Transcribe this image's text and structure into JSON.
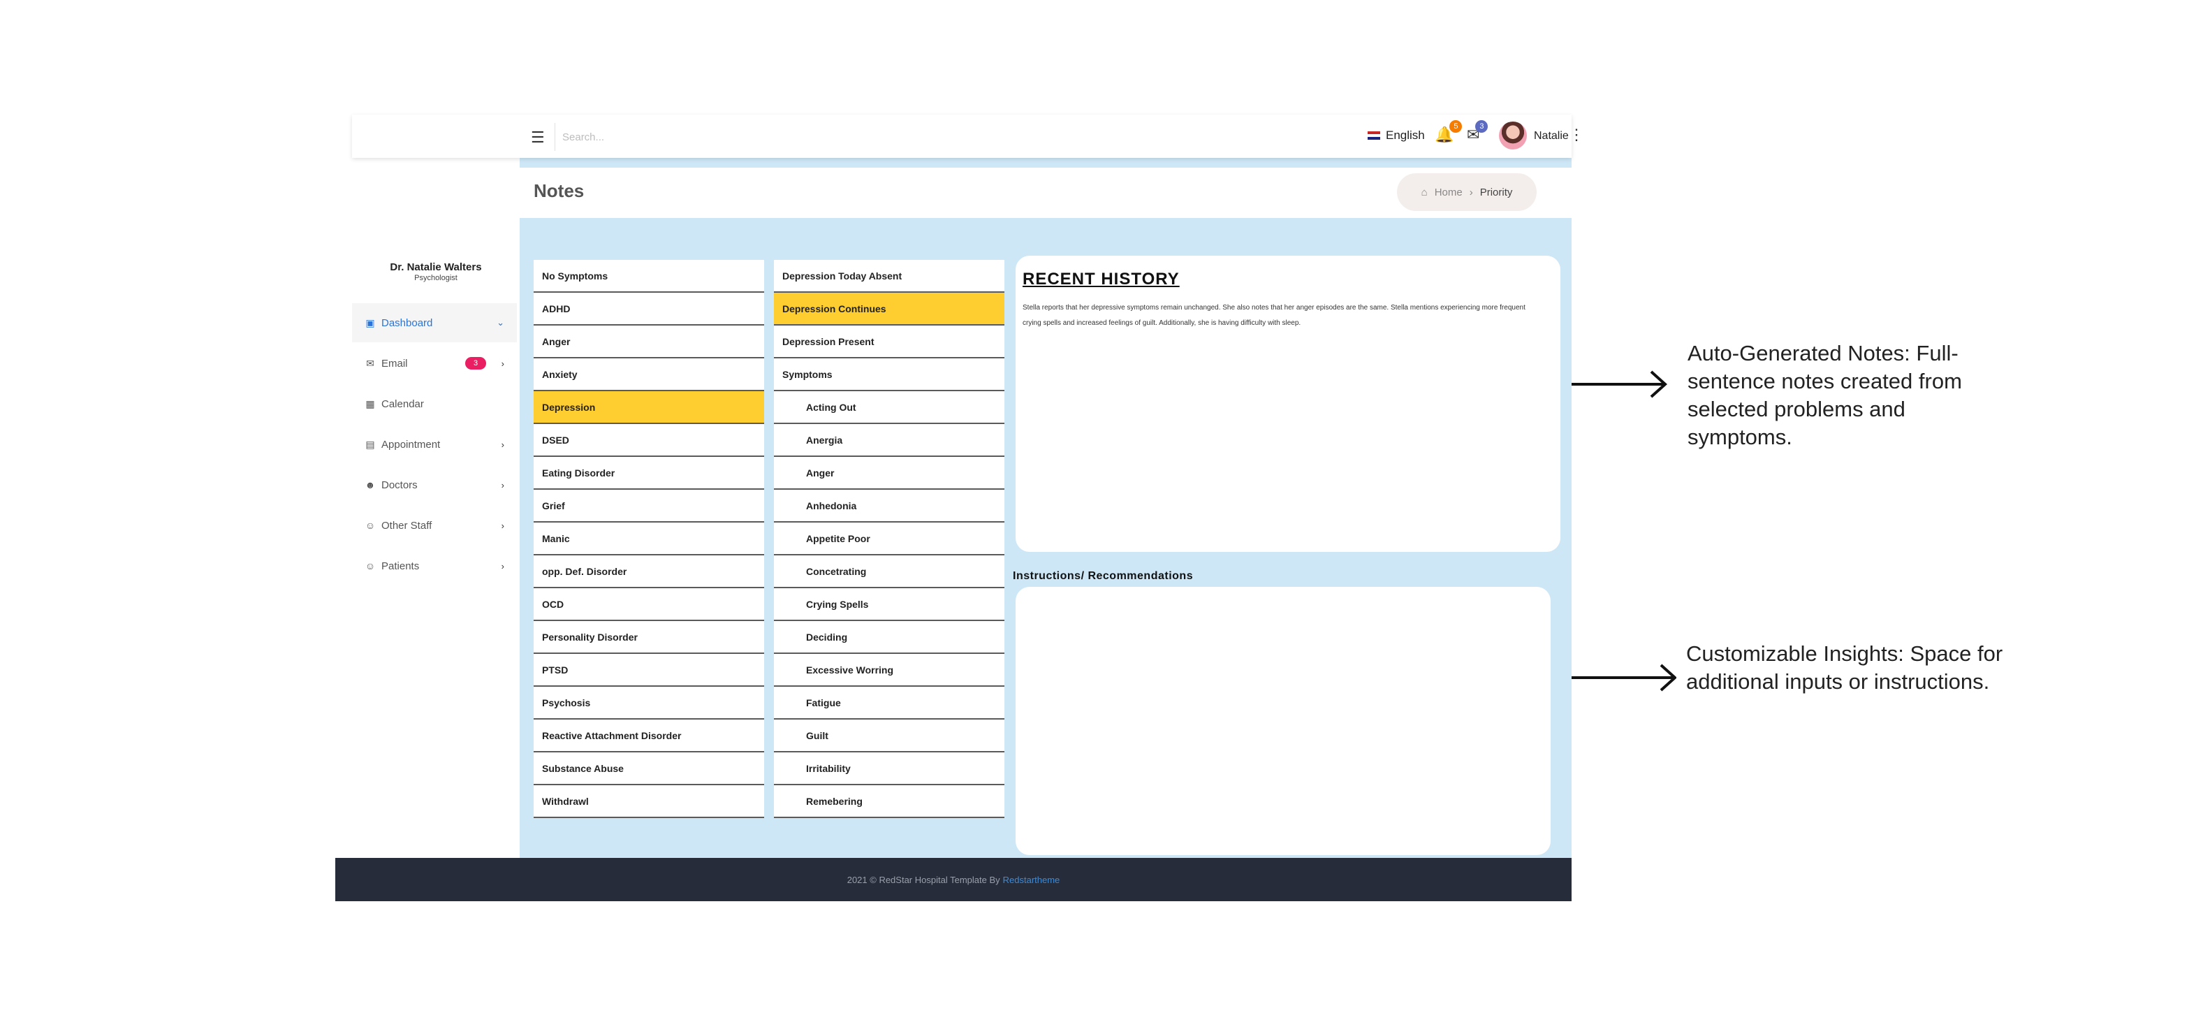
{
  "topbar": {
    "search_placeholder": "Search...",
    "language": "English",
    "notifications_count": "5",
    "messages_count": "3",
    "user_name": "Natalie",
    "menu_icon": "hamburger-icon",
    "colors": {
      "notif_badge": "#f57c00",
      "mail_badge": "#5c6bc0"
    }
  },
  "sidebar": {
    "doctor_name": "Dr. Natalie Walters",
    "doctor_role": "Psychologist",
    "items": [
      {
        "label": "Dashboard",
        "icon": "monitor-icon",
        "active": true
      },
      {
        "label": "Email",
        "icon": "mail-icon",
        "badge": "3"
      },
      {
        "label": "Calendar",
        "icon": "calendar-icon"
      },
      {
        "label": "Appointment",
        "icon": "book-icon"
      },
      {
        "label": "Doctors",
        "icon": "user-icon"
      },
      {
        "label": "Other Staff",
        "icon": "users-icon"
      },
      {
        "label": "Patients",
        "icon": "smile-icon"
      }
    ]
  },
  "header": {
    "title": "Notes",
    "breadcrumb": {
      "home": "Home",
      "current": "Priority"
    }
  },
  "problems": [
    {
      "label": "No Symptoms"
    },
    {
      "label": "ADHD"
    },
    {
      "label": "Anger"
    },
    {
      "label": "Anxiety"
    },
    {
      "label": "Depression",
      "selected": true
    },
    {
      "label": "DSED"
    },
    {
      "label": "Eating Disorder"
    },
    {
      "label": "Grief"
    },
    {
      "label": "Manic"
    },
    {
      "label": "opp. Def. Disorder"
    },
    {
      "label": "OCD"
    },
    {
      "label": "Personality Disorder"
    },
    {
      "label": "PTSD"
    },
    {
      "label": "Psychosis"
    },
    {
      "label": "Reactive Attachment Disorder"
    },
    {
      "label": "Substance Abuse"
    },
    {
      "label": "Withdrawl"
    }
  ],
  "symptoms": [
    {
      "label": "Depression Today Absent"
    },
    {
      "label": "Depression Continues",
      "selected": true
    },
    {
      "label": "Depression Present"
    },
    {
      "label": "Symptoms"
    },
    {
      "label": "Acting Out",
      "indent": true
    },
    {
      "label": "Anergia",
      "indent": true
    },
    {
      "label": "Anger",
      "indent": true
    },
    {
      "label": "Anhedonia",
      "indent": true
    },
    {
      "label": "Appetite Poor",
      "indent": true
    },
    {
      "label": "Concetrating",
      "indent": true
    },
    {
      "label": "Crying Spells",
      "indent": true
    },
    {
      "label": "Deciding",
      "indent": true
    },
    {
      "label": "Excessive Worring",
      "indent": true
    },
    {
      "label": "Fatigue",
      "indent": true
    },
    {
      "label": "Guilt",
      "indent": true
    },
    {
      "label": "Irritability",
      "indent": true
    },
    {
      "label": "Remebering",
      "indent": true
    }
  ],
  "history": {
    "title": "RECENT HISTORY",
    "text": "Stella reports that her depressive symptoms remain unchanged. She also notes that her anger episodes are the same. Stella mentions experiencing more frequent crying spells and increased feelings of guilt. Additionally, she is having difficulty with sleep."
  },
  "instructions": {
    "label": "Instructions/ Recommendations"
  },
  "footer": {
    "text": "2021 © RedStar Hospital Template By",
    "link": "Redstartheme"
  },
  "annotations": [
    {
      "text": "Auto-Generated Notes: Full-sentence notes created from selected problems and symptoms."
    },
    {
      "text": "Customizable Insights: Space for additional inputs or instructions."
    }
  ],
  "colors": {
    "content_bg": "#cde7f7",
    "selected_row": "#fecd2f",
    "footer_bg": "#262c3a",
    "active_nav": "#2a73d8"
  }
}
